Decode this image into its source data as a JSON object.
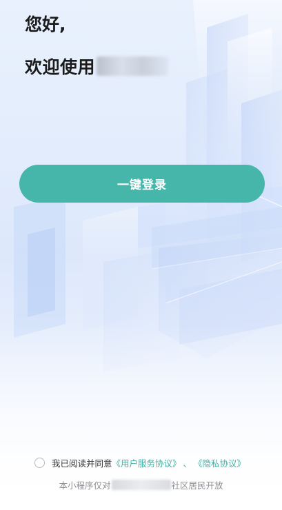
{
  "greeting": {
    "hello": "您好,",
    "welcome_prefix": "欢迎使用"
  },
  "login": {
    "button_label": "一键登录"
  },
  "agreement": {
    "prefix": "我已阅读并同意",
    "user_service_link": "《用户服务协议》",
    "separator": "、",
    "privacy_link": "《隐私协议》",
    "checked": false
  },
  "footer": {
    "scope_prefix": "本小程序仅对",
    "scope_suffix": "社区居民开放"
  },
  "colors": {
    "accent": "#45b6a9",
    "link": "#3fb1a3"
  }
}
